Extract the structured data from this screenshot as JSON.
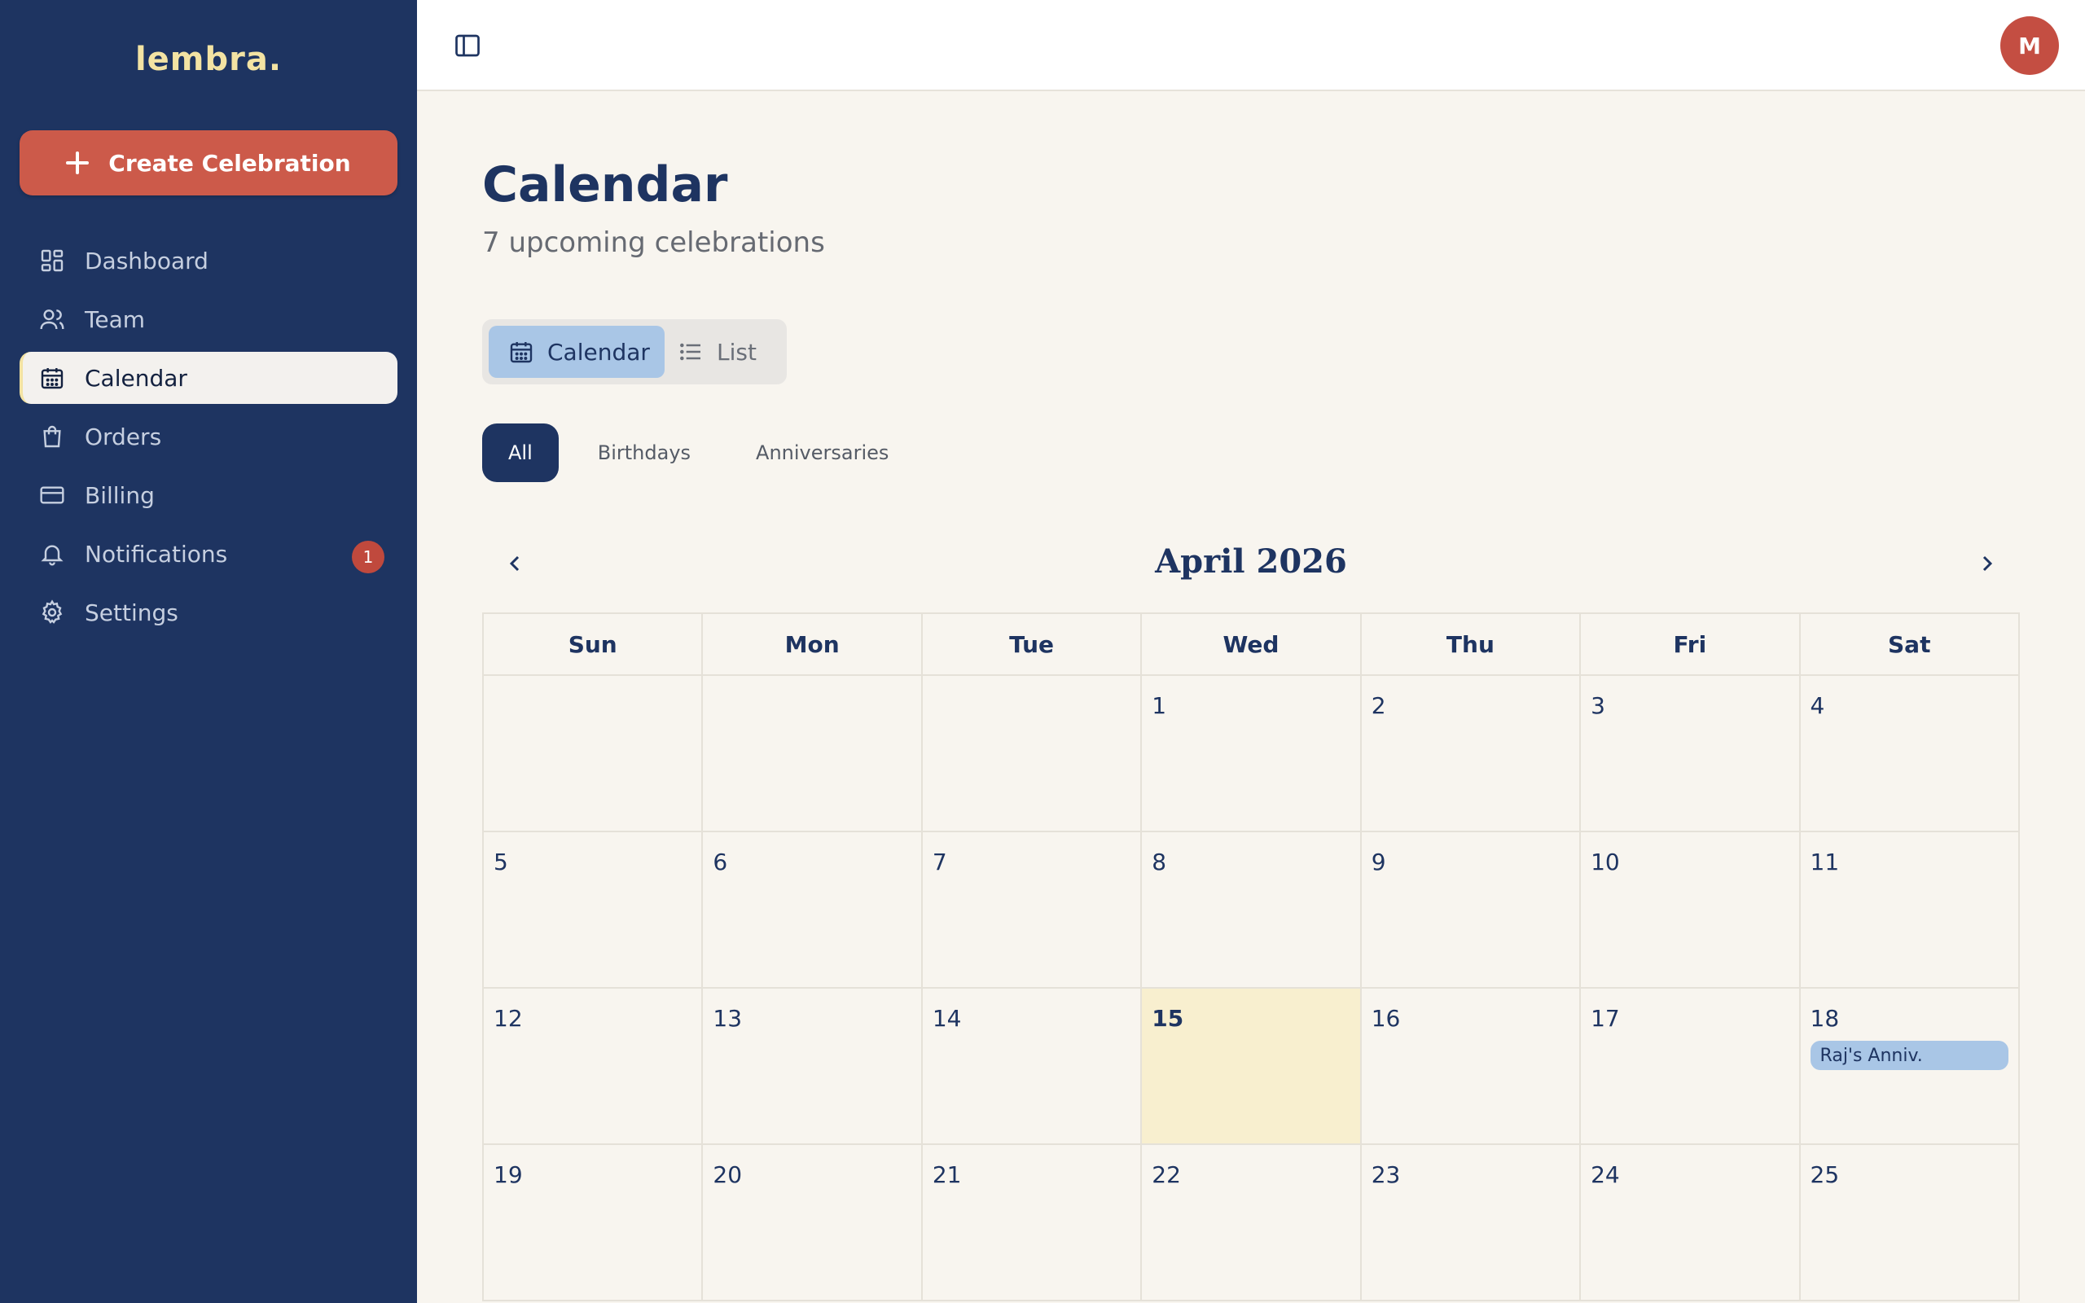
{
  "brand": {
    "logo": "lembra.",
    "logo_color": "#f3e3a3",
    "sidebar_bg": "#1e3461",
    "accent": "#cc5a4a"
  },
  "sidebar": {
    "create_label": "Create Celebration",
    "items": [
      {
        "label": "Dashboard",
        "icon": "dashboard-icon"
      },
      {
        "label": "Team",
        "icon": "team-icon"
      },
      {
        "label": "Calendar",
        "icon": "calendar-icon",
        "active": true
      },
      {
        "label": "Orders",
        "icon": "shopping-bag-icon"
      },
      {
        "label": "Billing",
        "icon": "credit-card-icon"
      },
      {
        "label": "Notifications",
        "icon": "bell-icon",
        "badge": "1"
      },
      {
        "label": "Settings",
        "icon": "gear-icon"
      }
    ]
  },
  "header": {
    "avatar_initial": "M",
    "toggle_icon": "sidebar-toggle-icon"
  },
  "main": {
    "title": "Calendar",
    "subtitle": "7 upcoming celebrations",
    "view_toggle": {
      "calendar_label": "Calendar",
      "list_label": "List",
      "selected": "Calendar"
    },
    "filters": [
      "All",
      "Birthdays",
      "Anniversaries"
    ],
    "selected_filter": "All"
  },
  "calendar": {
    "month_label": "April 2026",
    "weekdays": [
      "Sun",
      "Mon",
      "Tue",
      "Wed",
      "Thu",
      "Fri",
      "Sat"
    ],
    "weeks": [
      [
        "",
        "",
        "",
        "1",
        "2",
        "3",
        "4"
      ],
      [
        "5",
        "6",
        "7",
        "8",
        "9",
        "10",
        "11"
      ],
      [
        "12",
        "13",
        "14",
        "15",
        "16",
        "17",
        "18"
      ],
      [
        "19",
        "20",
        "21",
        "22",
        "23",
        "24",
        "25"
      ]
    ],
    "today": "15",
    "events": [
      {
        "day": "18",
        "label": "Raj's Anniv."
      }
    ]
  }
}
